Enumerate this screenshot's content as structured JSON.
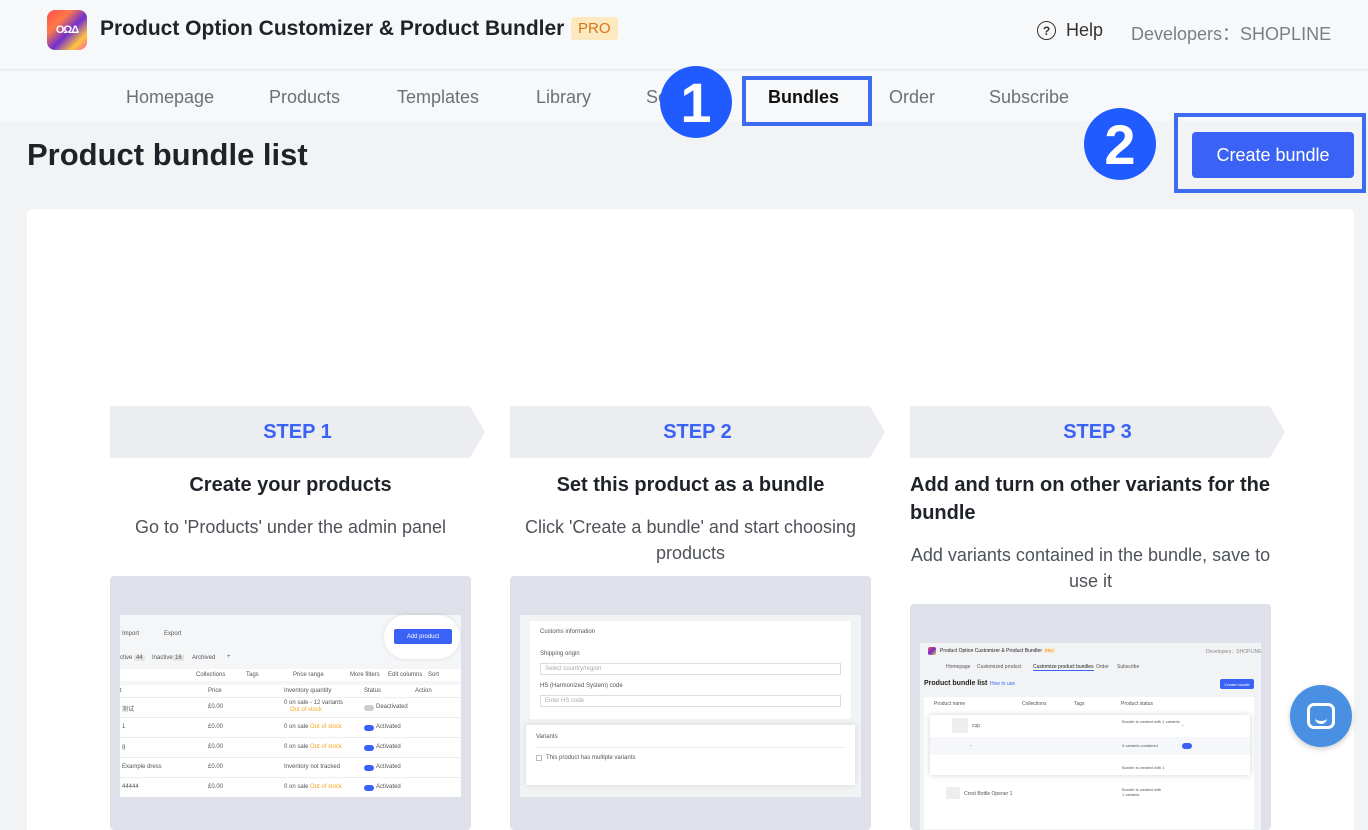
{
  "header": {
    "app_title": "Product Option Customizer & Product Bundler",
    "pro_badge": "PRO",
    "help_label": "Help",
    "developers": "Developers：SHOPLINE",
    "logo_text": "OΩΔ"
  },
  "nav": {
    "items": [
      "Homepage",
      "Products",
      "Templates",
      "Library",
      "Se",
      "Bundles",
      "Order",
      "Subscribe"
    ],
    "active": "Bundles"
  },
  "annotations": {
    "marker_1": "1",
    "marker_2": "2"
  },
  "page": {
    "title": "Product bundle list",
    "create_button": "Create bundle"
  },
  "steps": [
    {
      "label": "STEP 1",
      "heading": "Create your products",
      "description": "Go to 'Products' under the admin panel"
    },
    {
      "label": "STEP 2",
      "heading": "Set this product as a bundle",
      "description": "Click 'Create a bundle' and start choosing products"
    },
    {
      "label": "STEP 3",
      "heading": "Add and turn on other variants for the bundle",
      "description": "Add variants contained in the bundle, save to use it"
    }
  ],
  "shot1": {
    "import": "Import",
    "export": "Export",
    "add_product": "Add product",
    "tab_active": "ctive",
    "tab_active_count": "44",
    "tab_inactive": "Inactive",
    "tab_inactive_count": "16",
    "tab_archived": "Archived",
    "plus": "+",
    "filters": [
      "Collections",
      "Tags",
      "Price range",
      "More filters",
      "Edit columns",
      "Sort"
    ],
    "columns": [
      "t",
      "Price",
      "Inventory quantity",
      "Status",
      "Action"
    ],
    "rows": [
      {
        "name": "测试",
        "price": "£0.00",
        "inventory": "0 on sale - 12 variants",
        "stock_note": "Out of stock",
        "status": "Deactivated"
      },
      {
        "name": "1",
        "price": "£0.00",
        "inventory": "0 on sale",
        "stock_note": "Out of stock",
        "status": "Activated"
      },
      {
        "name": "g",
        "price": "£0.00",
        "inventory": "0 on sale",
        "stock_note": "Out of stock",
        "status": "Activated"
      },
      {
        "name": "Example dress",
        "price": "£0.00",
        "inventory": "Inventory not tracked",
        "stock_note": "",
        "status": "Activated"
      },
      {
        "name": "44444",
        "price": "£0.00",
        "inventory": "0 on sale",
        "stock_note": "Out of stock",
        "status": "Activated"
      }
    ]
  },
  "shot2": {
    "customs_title": "Customs information",
    "shipping_origin": "Shipping origin",
    "select_placeholder": "Select country/region",
    "hs_label": "HS (Harmonized System) code",
    "hs_placeholder": "Enter HS code",
    "variants_title": "Variants",
    "variants_checkbox": "This product has multiple variants"
  },
  "shot3": {
    "app_title": "Product Option Customizer & Product Bundler",
    "pro": "PRO",
    "developers": "Developers：SHOPLINE",
    "nav": [
      "Homepage",
      "Customized product",
      "Customize product bundles",
      "Order",
      "Subscribe"
    ],
    "title": "Product bundle list",
    "how_to_use": "How to use",
    "create_button": "Create bundle",
    "columns": [
      "Product name",
      "Collections",
      "Tags",
      "Product status"
    ],
    "row1_name": "cup",
    "row1_status": "Bundle is created with 1 variants",
    "row2_name": "-",
    "row2_status": "0 variants contained",
    "row3_status": "Bundle is created with 1",
    "row4_name": "Crest Bottle Opener 1",
    "row4_status": "Bundle is created with 1 variants",
    "dash": "-"
  }
}
